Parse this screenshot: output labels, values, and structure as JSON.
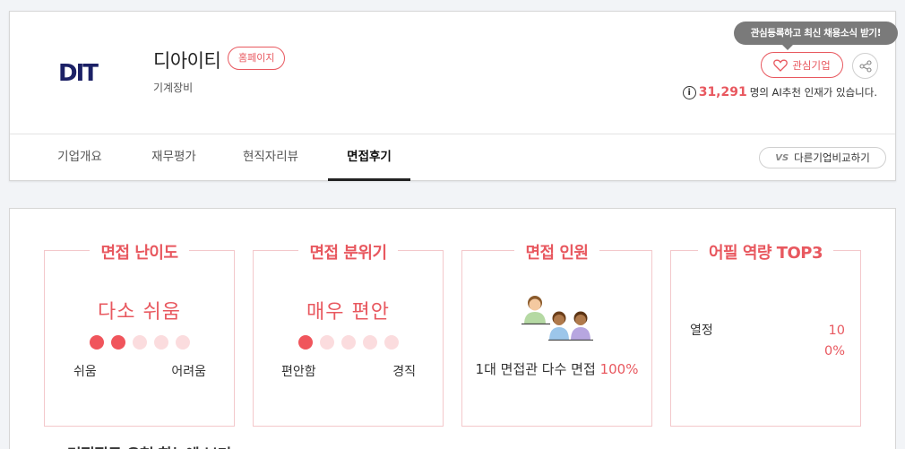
{
  "company": {
    "logo_text": "DIT",
    "name": "디아이티",
    "homepage_label": "홈페이지",
    "industry": "기계장비"
  },
  "actions": {
    "tooltip": "관심등록하고 최신 채용소식 받기!",
    "follow_label": "관심기업",
    "share_icon": "share-icon",
    "recommend_count": "31,291",
    "recommend_suffix": "명의 AI추천 인재가 있습니다."
  },
  "tabs": [
    {
      "label": "기업개요",
      "active": false
    },
    {
      "label": "재무평가",
      "active": false
    },
    {
      "label": "현직자리뷰",
      "active": false
    },
    {
      "label": "면접후기",
      "active": true
    }
  ],
  "compare": {
    "vs": "VS",
    "label": "다른기업비교하기"
  },
  "review": {
    "difficulty": {
      "title": "면접 난이도",
      "value": "다소 쉬움",
      "level": 2,
      "max": 5,
      "left": "쉬움",
      "right": "어려움"
    },
    "atmosphere": {
      "title": "면접 분위기",
      "value": "매우 편안",
      "level": 1,
      "max": 5,
      "left": "편안함",
      "right": "경직"
    },
    "interviewers": {
      "title": "면접 인원",
      "value": "1대 면접관 다수 면접",
      "percent": "100%"
    },
    "competency": {
      "title": "어필 역량 TOP3",
      "items": [
        {
          "label": "열정",
          "value_line1": "10",
          "value_line2": "0%"
        }
      ]
    },
    "next_heading": "면접질문 유형 한눈에 보기"
  },
  "colors": {
    "accent": "#e8585f",
    "dot_on": "#f0555c",
    "dot_off": "#fbdcde",
    "logo": "#1c2166"
  }
}
